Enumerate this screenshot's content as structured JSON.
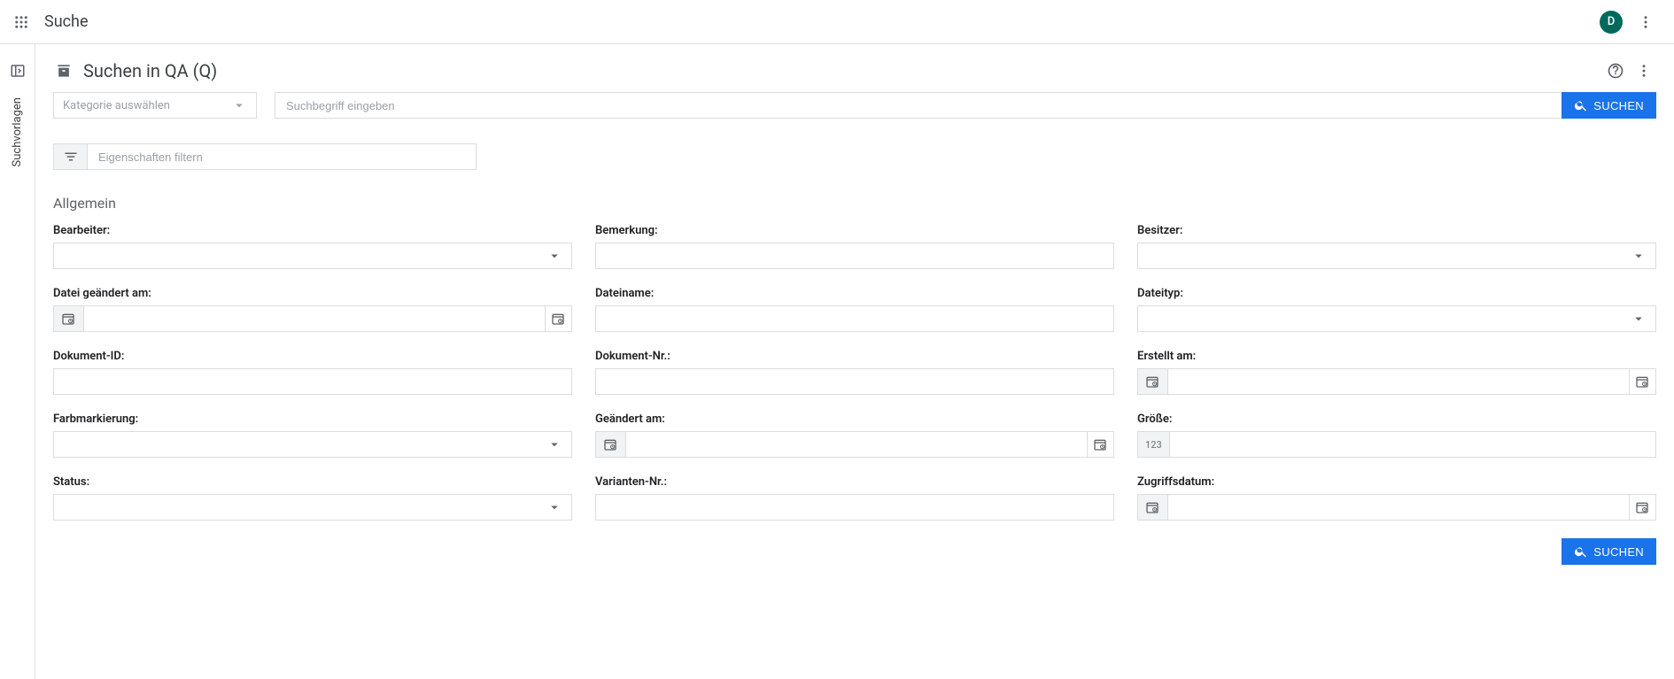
{
  "header": {
    "title": "Suche",
    "avatar_letter": "D"
  },
  "sidebar": {
    "label": "Suchvorlagen"
  },
  "page": {
    "heading": "Suchen in QA (Q)"
  },
  "search": {
    "category_placeholder": "Kategorie auswählen",
    "term_placeholder": "Suchbegriff eingeben",
    "button_label": "SUCHEN"
  },
  "filter": {
    "placeholder": "Eigenschaften filtern"
  },
  "section": {
    "general_label": "Allgemein"
  },
  "fields": {
    "bearbeiter": "Bearbeiter:",
    "bemerkung": "Bemerkung:",
    "besitzer": "Besitzer:",
    "datei_geaendert_am": "Datei geändert am:",
    "dateiname": "Dateiname:",
    "dateityp": "Dateityp:",
    "dokument_id": "Dokument-ID:",
    "dokument_nr": "Dokument-Nr.:",
    "erstellt_am": "Erstellt am:",
    "farbmarkierung": "Farbmarkierung:",
    "geaendert_am": "Geändert am:",
    "groesse": "Größe:",
    "status": "Status:",
    "varianten_nr": "Varianten-Nr.:",
    "zugriffsdatum": "Zugriffsdatum:",
    "num_placeholder": "123"
  },
  "footer": {
    "search_label": "SUCHEN"
  }
}
